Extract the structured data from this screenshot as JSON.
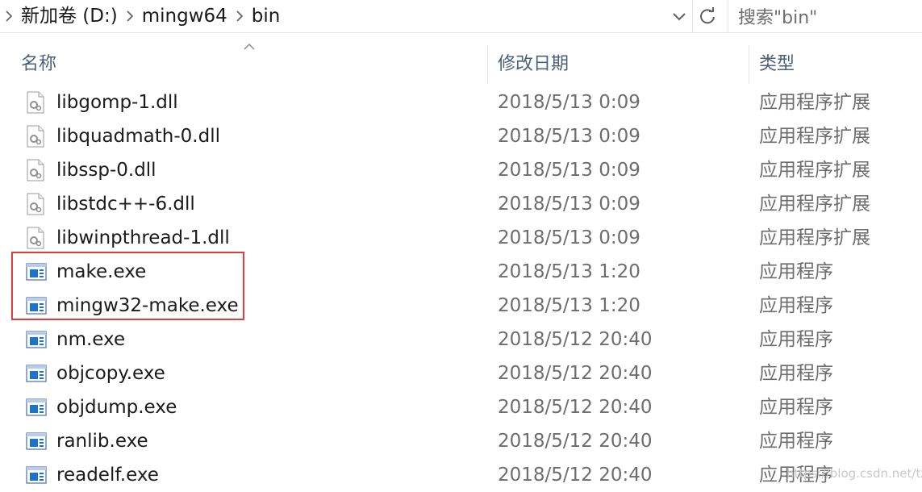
{
  "address": {
    "breadcrumbs": [
      "新加卷 (D:)",
      "mingw64",
      "bin"
    ]
  },
  "search": {
    "placeholder": "搜索\"bin\""
  },
  "columns": {
    "name": "名称",
    "date": "修改日期",
    "type": "类型"
  },
  "files": [
    {
      "name": "libgomp-1.dll",
      "date": "2018/5/13 0:09",
      "type": "应用程序扩展",
      "icon": "dll-file-icon"
    },
    {
      "name": "libquadmath-0.dll",
      "date": "2018/5/13 0:09",
      "type": "应用程序扩展",
      "icon": "dll-file-icon"
    },
    {
      "name": "libssp-0.dll",
      "date": "2018/5/13 0:09",
      "type": "应用程序扩展",
      "icon": "dll-file-icon"
    },
    {
      "name": "libstdc++-6.dll",
      "date": "2018/5/13 0:09",
      "type": "应用程序扩展",
      "icon": "dll-file-icon"
    },
    {
      "name": "libwinpthread-1.dll",
      "date": "2018/5/13 0:09",
      "type": "应用程序扩展",
      "icon": "dll-file-icon"
    },
    {
      "name": "make.exe",
      "date": "2018/5/13 1:20",
      "type": "应用程序",
      "icon": "exe-file-icon"
    },
    {
      "name": "mingw32-make.exe",
      "date": "2018/5/13 1:20",
      "type": "应用程序",
      "icon": "exe-file-icon"
    },
    {
      "name": "nm.exe",
      "date": "2018/5/12 20:40",
      "type": "应用程序",
      "icon": "exe-file-icon"
    },
    {
      "name": "objcopy.exe",
      "date": "2018/5/12 20:40",
      "type": "应用程序",
      "icon": "exe-file-icon"
    },
    {
      "name": "objdump.exe",
      "date": "2018/5/12 20:40",
      "type": "应用程序",
      "icon": "exe-file-icon"
    },
    {
      "name": "ranlib.exe",
      "date": "2018/5/12 20:40",
      "type": "应用程序",
      "icon": "exe-file-icon"
    },
    {
      "name": "readelf.exe",
      "date": "2018/5/12 20:40",
      "type": "应用程序",
      "icon": "exe-file-icon"
    }
  ],
  "watermark": "https://blog.csdn.net/tzr0725",
  "colors": {
    "highlight": "#e03c3c",
    "header_text": "#4c607a",
    "exe_icon_blue": "#1e73c8"
  }
}
